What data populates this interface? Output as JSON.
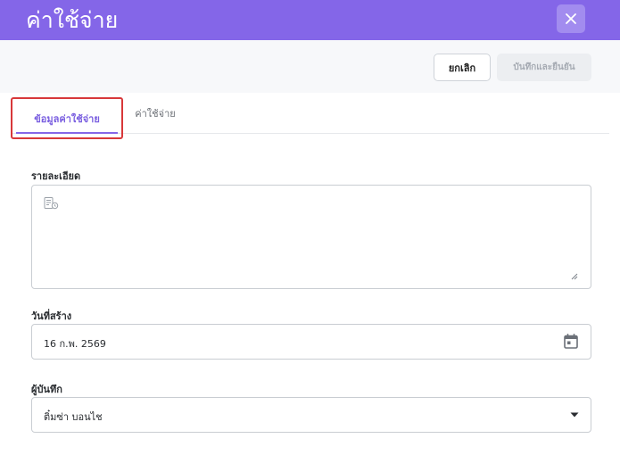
{
  "header": {
    "title": "ค่าใช้จ่าย",
    "close_icon": "close-icon"
  },
  "toolbar": {
    "cancel_label": "ยกเลิก",
    "save_label": "บันทึกและยืนยัน"
  },
  "tabs": [
    {
      "label": "ข้อมูลค่าใช้จ่าย",
      "active": true
    },
    {
      "label": "ค่าใช้จ่าย",
      "active": false
    }
  ],
  "form": {
    "details": {
      "label": "รายละเอียด",
      "value": "",
      "icon": "note-icon"
    },
    "created_date": {
      "label": "วันที่สร้าง",
      "value": "16 ก.พ. 2569",
      "icon": "calendar-icon"
    },
    "recorder": {
      "label": "ผู้บันทึก",
      "value": "ติ๋มซ่า บอนไช",
      "icon": "caret-down-icon"
    }
  },
  "colors": {
    "brand": "#8466e8",
    "highlight": "#d8383a"
  }
}
